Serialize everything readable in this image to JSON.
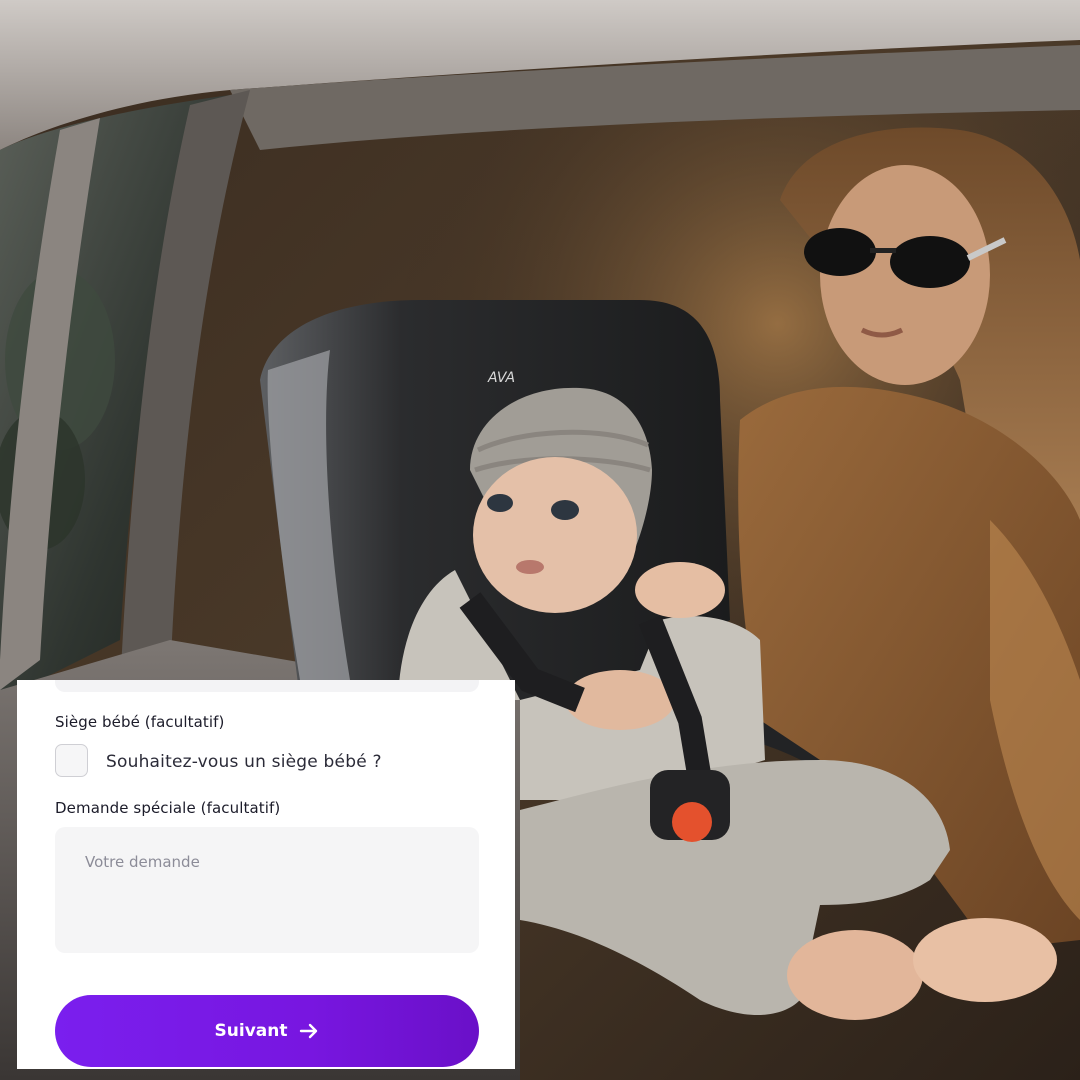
{
  "form": {
    "seat_label": "Siège bébé (facultatif)",
    "seat_checkbox_text": "Souhaitez-vous un siège bébé ?",
    "seat_checked": false,
    "request_label": "Demande spéciale (facultatif)",
    "request_placeholder": "Votre demande",
    "request_value": "",
    "next_label": "Suivant",
    "next_icon": "arrow-right-icon"
  },
  "colors": {
    "accent": "#7a1fee",
    "accent_dark": "#6a10c8",
    "field_bg": "#f5f5f6",
    "text": "#1c1c2a",
    "placeholder": "#8c8c98"
  },
  "photo": {
    "seat_logo": "AVA",
    "subject": "baby-in-car-seat-with-woman-in-sunglasses"
  }
}
